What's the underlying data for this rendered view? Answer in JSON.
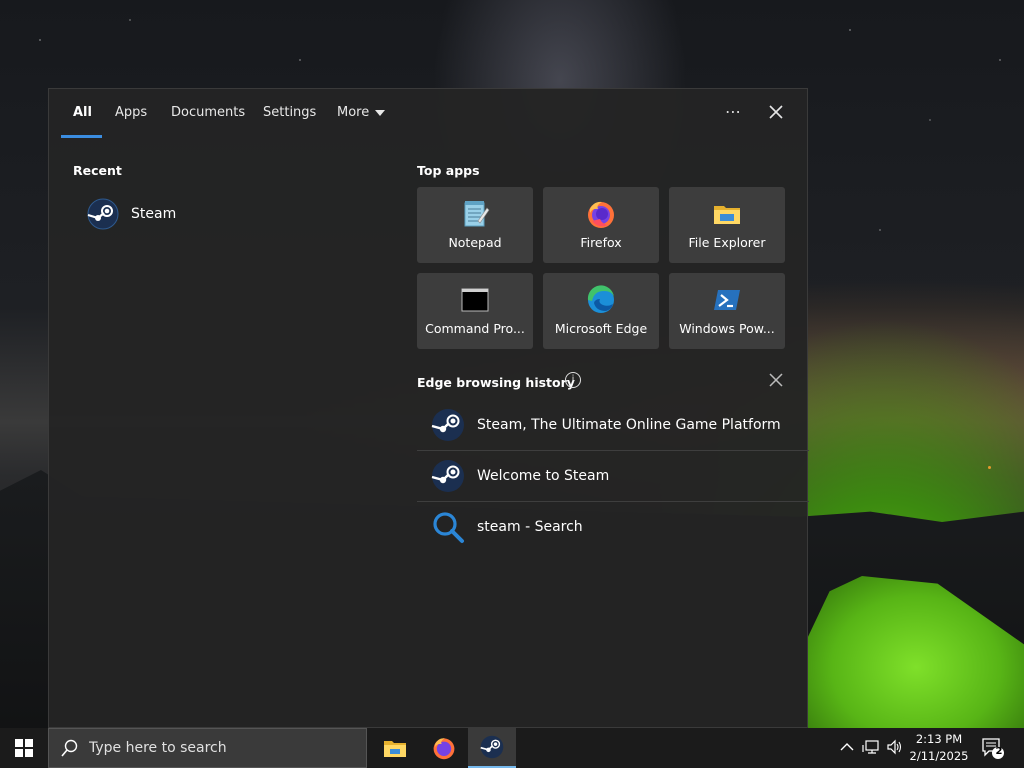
{
  "panel": {
    "tabs": [
      {
        "label": "All"
      },
      {
        "label": "Apps"
      },
      {
        "label": "Documents"
      },
      {
        "label": "Settings"
      },
      {
        "label": "More"
      }
    ],
    "more_icon": "more-dots-icon",
    "close_icon": "close-icon"
  },
  "recent": {
    "title": "Recent",
    "items": [
      {
        "label": "Steam",
        "icon": "steam-icon"
      }
    ]
  },
  "top_apps": {
    "title": "Top apps",
    "items": [
      {
        "label": "Notepad",
        "icon": "notepad-icon"
      },
      {
        "label": "Firefox",
        "icon": "firefox-icon"
      },
      {
        "label": "File Explorer",
        "icon": "file-explorer-icon"
      },
      {
        "label": "Command Pro...",
        "icon": "command-prompt-icon"
      },
      {
        "label": "Microsoft Edge",
        "icon": "edge-icon"
      },
      {
        "label": "Windows Pow...",
        "icon": "powershell-icon"
      }
    ]
  },
  "history": {
    "title": "Edge browsing history",
    "info_glyph": "i",
    "items": [
      {
        "label": "Steam, The Ultimate Online Game Platform",
        "icon": "steam-icon"
      },
      {
        "label": "Welcome to Steam",
        "icon": "steam-icon"
      },
      {
        "label": "steam - Search",
        "icon": "search-icon"
      }
    ]
  },
  "taskbar": {
    "search_placeholder": "Type here to search",
    "clock_time": "2:13 PM",
    "clock_date": "2/11/2025",
    "notification_count": "2",
    "accent": "#76b9ed"
  },
  "colors": {
    "panel_bg": "#242424",
    "tile_bg": "#3d3d3d",
    "tab_underline": "#3b8de0"
  }
}
